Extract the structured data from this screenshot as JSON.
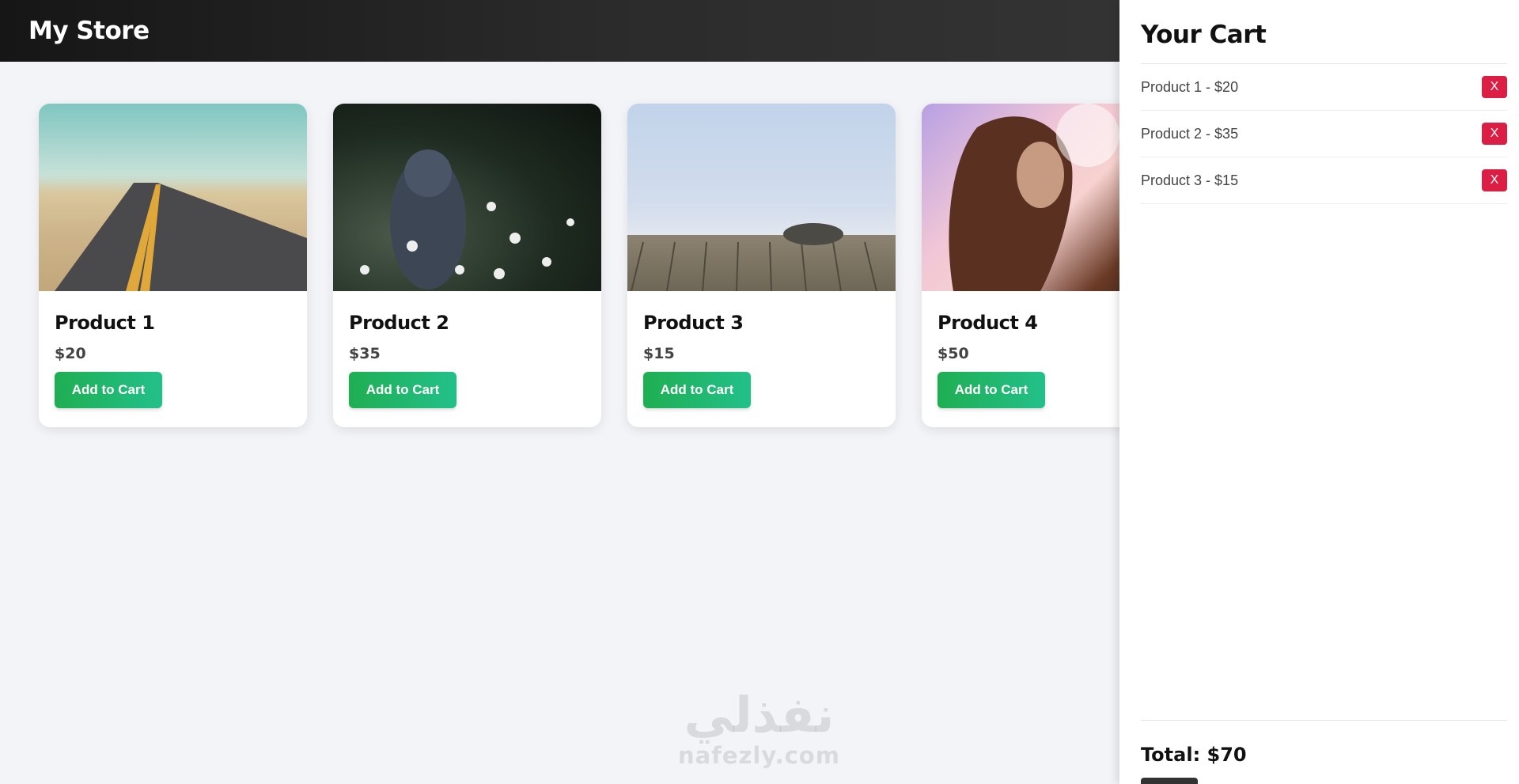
{
  "header": {
    "title": "My Store"
  },
  "products": [
    {
      "name": "Product 1",
      "price": "$20",
      "button": "Add to Cart",
      "image": "desert-road-photo"
    },
    {
      "name": "Product 2",
      "price": "$35",
      "button": "Add to Cart",
      "image": "person-in-daisies-photo"
    },
    {
      "name": "Product 3",
      "price": "$15",
      "button": "Add to Cart",
      "image": "foggy-dock-photo"
    },
    {
      "name": "Product 4",
      "price": "$50",
      "button": "Add to Cart",
      "image": "woman-in-sunlight-photo"
    }
  ],
  "cart": {
    "title": "Your Cart",
    "items": [
      {
        "label": "Product 1 - $20",
        "remove": "X"
      },
      {
        "label": "Product 2 - $35",
        "remove": "X"
      },
      {
        "label": "Product 3 - $15",
        "remove": "X"
      }
    ],
    "total": "Total: $70"
  },
  "watermark": {
    "arabic": "نفذلي",
    "latin": "nafezly.com"
  },
  "colors": {
    "header_bg": "#1c1c1c",
    "add_button": "#1fae52",
    "remove_button": "#dc1e44",
    "page_bg": "#f3f4f8"
  }
}
